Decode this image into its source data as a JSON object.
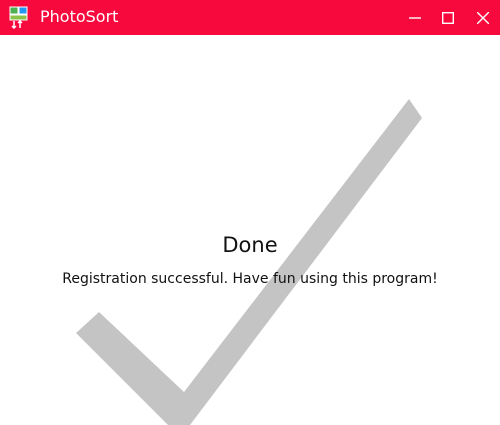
{
  "window": {
    "title": "PhotoSort",
    "titlebar_color": "#f7093e",
    "controls": [
      "minimize-icon",
      "maximize-icon",
      "close-icon"
    ]
  },
  "dialog": {
    "heading": "Done",
    "message": "Registration successful. Have fun using this program!",
    "checkmark_color": "#c4c4c4",
    "checkmark_icon": "checkmark-icon"
  }
}
